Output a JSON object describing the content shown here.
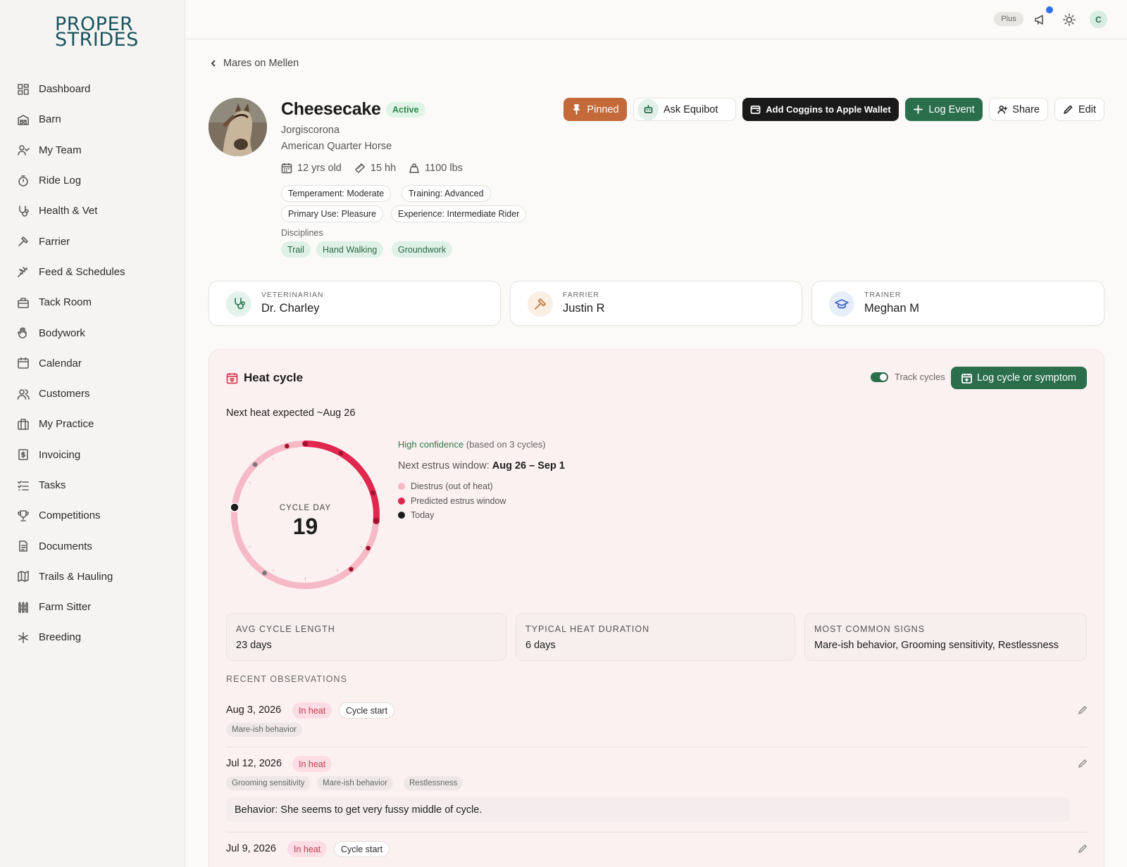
{
  "brand": {
    "line1": "PROPER",
    "line2": "STRIDES"
  },
  "nav": [
    {
      "label": "Dashboard",
      "icon": "dashboard-icon"
    },
    {
      "label": "Barn",
      "icon": "barn-icon"
    },
    {
      "label": "My Team",
      "icon": "team-icon"
    },
    {
      "label": "Ride Log",
      "icon": "stopwatch-icon"
    },
    {
      "label": "Health & Vet",
      "icon": "stethoscope-icon"
    },
    {
      "label": "Farrier",
      "icon": "hammer-icon"
    },
    {
      "label": "Feed & Schedules",
      "icon": "wheat-icon"
    },
    {
      "label": "Tack Room",
      "icon": "box-icon"
    },
    {
      "label": "Bodywork",
      "icon": "hand-icon"
    },
    {
      "label": "Calendar",
      "icon": "calendar-icon"
    },
    {
      "label": "Customers",
      "icon": "customers-icon"
    },
    {
      "label": "My Practice",
      "icon": "briefcase-icon"
    },
    {
      "label": "Invoicing",
      "icon": "invoice-icon"
    },
    {
      "label": "Tasks",
      "icon": "tasks-icon"
    },
    {
      "label": "Competitions",
      "icon": "trophy-icon"
    },
    {
      "label": "Documents",
      "icon": "document-icon"
    },
    {
      "label": "Trails & Hauling",
      "icon": "map-icon"
    },
    {
      "label": "Farm Sitter",
      "icon": "fence-icon"
    },
    {
      "label": "Breeding",
      "icon": "breeding-icon"
    }
  ],
  "topbar": {
    "plan": "Plus",
    "avatar": "C"
  },
  "breadcrumb": "Mares on Mellen",
  "horse": {
    "name": "Cheesecake",
    "status": "Active",
    "owner": "Jorgiscorona",
    "breed": "American Quarter Horse",
    "age": "12 yrs old",
    "height": "15 hh",
    "weight": "1100 lbs",
    "traits": [
      "Temperament: Moderate",
      "Training: Advanced",
      "Primary Use: Pleasure",
      "Experience: Intermediate Rider"
    ],
    "disciplines_label": "Disciplines",
    "disciplines": [
      "Trail",
      "Hand Walking",
      "Groundwork"
    ]
  },
  "actions": {
    "pinned": "Pinned",
    "ask": "Ask Equibot",
    "wallet": "Add Coggins to Apple Wallet",
    "log_event": "Log Event",
    "share": "Share",
    "edit": "Edit"
  },
  "contacts": [
    {
      "role": "VETERINARIAN",
      "name": "Dr. Charley"
    },
    {
      "role": "FARRIER",
      "name": "Justin R"
    },
    {
      "role": "TRAINER",
      "name": "Meghan M"
    }
  ],
  "heat": {
    "title": "Heat cycle",
    "track_label": "Track cycles",
    "track_on": true,
    "log_button": "Log cycle or symptom",
    "next_heat": "Next heat expected ~Aug 26",
    "cycle_day_label": "CYCLE DAY",
    "cycle_day": "19",
    "confidence": "High confidence",
    "confidence_note": "(based on 3 cycles)",
    "window_label": "Next estrus window:",
    "window_value": "Aug 26 – Sep 1",
    "legend": [
      {
        "label": "Diestrus (out of heat)",
        "color": "#f6b9c6"
      },
      {
        "label": "Predicted estrus window",
        "color": "#e0274d"
      },
      {
        "label": "Today",
        "color": "#1c1c1c"
      }
    ],
    "stats": [
      {
        "label": "AVG CYCLE LENGTH",
        "value": "23 days"
      },
      {
        "label": "TYPICAL HEAT DURATION",
        "value": "6 days"
      },
      {
        "label": "MOST COMMON SIGNS",
        "value": "Mare-ish behavior, Grooming sensitivity, Restlessness"
      }
    ],
    "observations_label": "RECENT OBSERVATIONS",
    "observations": [
      {
        "date": "Aug 3, 2026",
        "status": "In heat",
        "tag": "Cycle start",
        "symptoms": [
          "Mare-ish behavior"
        ]
      },
      {
        "date": "Jul 12, 2026",
        "status": "In heat",
        "symptoms": [
          "Grooming sensitivity",
          "Mare-ish behavior",
          "Restlessness"
        ],
        "note": "Behavior: She seems to get very fussy middle of cycle."
      },
      {
        "date": "Jul 9, 2026",
        "status": "In heat",
        "tag": "Cycle start"
      }
    ]
  }
}
